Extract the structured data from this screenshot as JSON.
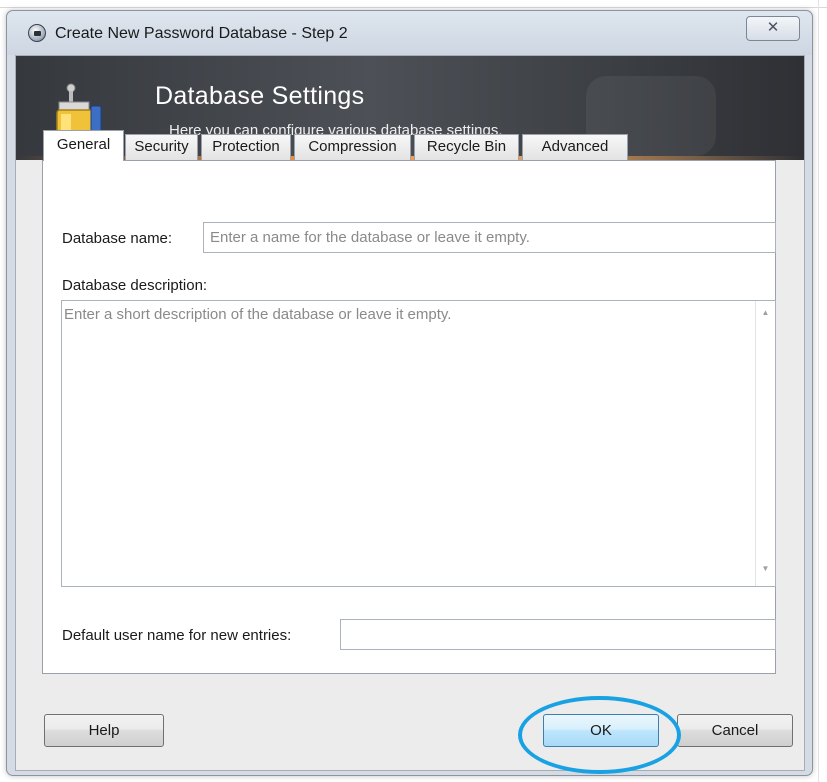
{
  "window": {
    "title": "Create New Password Database - Step 2",
    "close_glyph": "✕"
  },
  "banner": {
    "title": "Database Settings",
    "subtitle": "Here you can configure various database settings."
  },
  "tabs": [
    {
      "label": "General",
      "active": true
    },
    {
      "label": "Security",
      "active": false
    },
    {
      "label": "Protection",
      "active": false
    },
    {
      "label": "Compression",
      "active": false
    },
    {
      "label": "Recycle Bin",
      "active": false
    },
    {
      "label": "Advanced",
      "active": false
    }
  ],
  "general": {
    "db_name_label": "Database name:",
    "db_name_value": "",
    "db_name_placeholder": "Enter a name for the database or leave it empty.",
    "db_desc_label": "Database description:",
    "db_desc_value": "",
    "db_desc_placeholder": "Enter a short description of the database or leave it empty.",
    "default_user_label": "Default user name for new entries:",
    "default_user_value": ""
  },
  "buttons": {
    "help": "Help",
    "ok": "OK",
    "cancel": "Cancel"
  },
  "colors": {
    "highlight_ring": "#19a2e3",
    "banner_accent": "#f08c32",
    "default_button_border": "#3c7fb1"
  },
  "icons": {
    "title": "lock-icon",
    "banner": "database-settings-icon",
    "close": "close-icon",
    "scroll_up": "scroll-up-arrow-icon",
    "scroll_down": "scroll-down-arrow-icon"
  }
}
